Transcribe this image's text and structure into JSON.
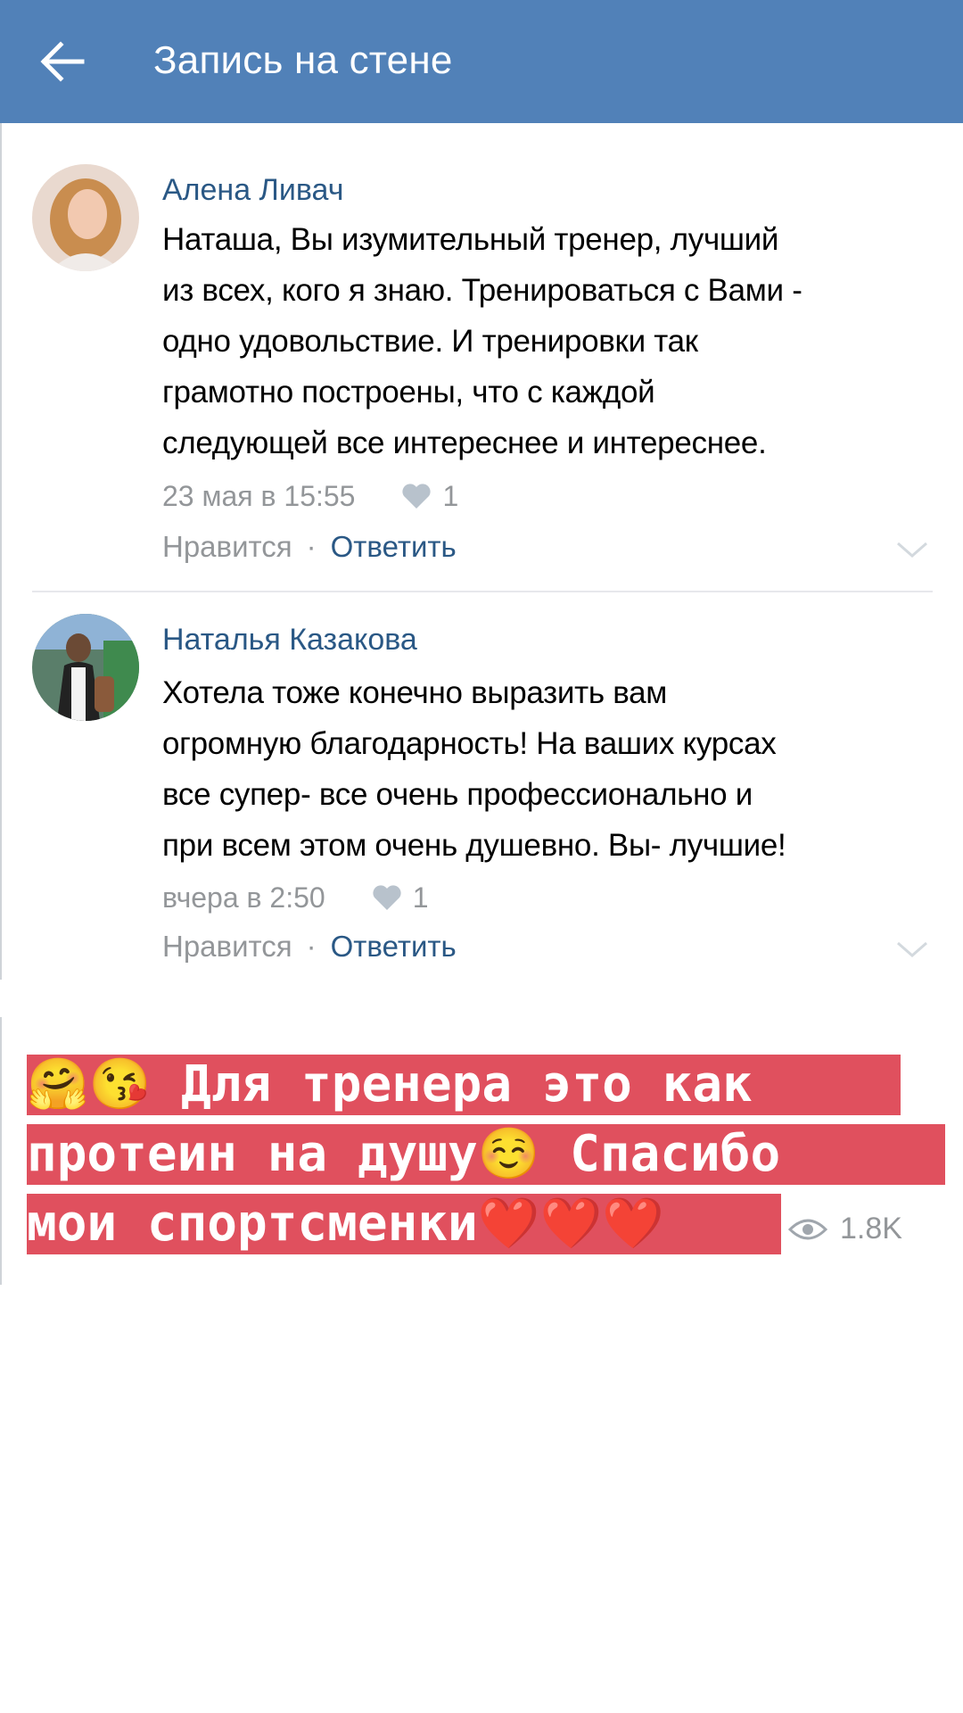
{
  "header": {
    "title": "Запись на стене",
    "back_icon": "arrow-left-icon",
    "color": "#5181b8"
  },
  "comments": [
    {
      "author": "Алена Ливач",
      "lines": [
        "Наташа, Вы изумительный тренер, лучший",
        "из всех, кого я знаю. Тренироваться с Вами -",
        "одно удовольствие. И тренировки так",
        "грамотно построены, что с каждой",
        "следующей все интереснее и интереснее."
      ],
      "time": "23 мая в 15:55",
      "likes": "1",
      "like_label": "Нравится",
      "separator": "·",
      "reply_label": "Ответить"
    },
    {
      "author": "Наталья Казакова",
      "lines": [
        "Хотела тоже конечно выразить вам",
        "огромную благодарность! На ваших курсах",
        "все супер- все очень профессионально и",
        "при всем этом очень душевно. Вы- лучшие!"
      ],
      "time": "вчера в 2:50",
      "likes": "1",
      "like_label": "Нравится",
      "separator": "·",
      "reply_label": "Ответить"
    }
  ],
  "caption": {
    "line1": "🤗😘 Для тренера это как",
    "line2": "протеин на душу☺️ Спасибо",
    "line3": "мои спортсменки❤️❤️❤️",
    "background": "#e0505e"
  },
  "views": {
    "icon": "eye-icon",
    "count": "1.8K"
  }
}
